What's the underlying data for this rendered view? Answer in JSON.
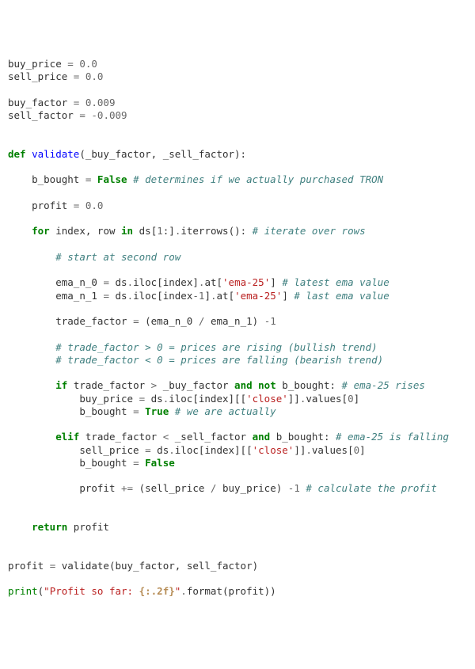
{
  "code": {
    "l01": {
      "n1": "buy_price",
      "op": "=",
      "num": "0.0"
    },
    "l02": {
      "n1": "sell_price",
      "op": "=",
      "num": "0.0"
    },
    "l04": {
      "n1": "buy_factor",
      "op": "=",
      "num": "0.009"
    },
    "l05": {
      "n1": "sell_factor",
      "op": "=",
      "num": "-0.009"
    },
    "l08": {
      "kw": "def",
      "fn": "validate",
      "p1": "(",
      "a1": "_buy_factor",
      "a2": "_sell_factor",
      "p2": "):"
    },
    "l10": {
      "n1": "b_bought",
      "op": "=",
      "kc": "False",
      "c": "# determines if we actually purchased TRON"
    },
    "l12": {
      "n1": "profit",
      "op": "=",
      "num": "0.0"
    },
    "l14": {
      "k1": "for",
      "n1": "index",
      "n2": "row",
      "k2": "in",
      "n3": "ds",
      "p1": "[",
      "m1": "1",
      "p2": ":]",
      "p3": ".",
      "n4": "iterrows",
      "p4": "():",
      "c": "# iterate over rows"
    },
    "l16": {
      "c": "# start at second row"
    },
    "l18": {
      "n1": "ema_n_0",
      "op": "=",
      "n2": "ds",
      "p1": ".",
      "n3": "iloc",
      "p2": "[",
      "n4": "index",
      "p3": "]",
      "p4": ".",
      "n5": "at",
      "p5": "[",
      "s1": "'ema-25'",
      "p6": "]",
      "c": "# latest ema value"
    },
    "l19": {
      "n1": "ema_n_1",
      "op": "=",
      "n2": "ds",
      "p1": ".",
      "n3": "iloc",
      "p2": "[",
      "n4": "index",
      "op2": "-",
      "m1": "1",
      "p3": "]",
      "p4": ".",
      "n5": "at",
      "p5": "[",
      "s1": "'ema-25'",
      "p6": "]",
      "c": "# last ema value"
    },
    "l21": {
      "n1": "trade_factor",
      "op": "=",
      "p1": "(",
      "n2": "ema_n_0",
      "op2": "/",
      "n3": "ema_n_1",
      "p2": ")",
      "op3": "-",
      "m1": "1"
    },
    "l23": {
      "c": "# trade_factor > 0 = prices are rising (bullish trend)"
    },
    "l24": {
      "c": "# trade_factor < 0 = prices are falling (bearish trend)"
    },
    "l26": {
      "k1": "if",
      "n1": "trade_factor",
      "op": ">",
      "n2": "_buy_factor",
      "k2": "and",
      "k3": "not",
      "n3": "b_bought",
      "p1": ":",
      "c": "# ema-25 rises"
    },
    "l27": {
      "n1": "buy_price",
      "op": "=",
      "n2": "ds",
      "p1": ".",
      "n3": "iloc",
      "p2": "[",
      "n4": "index",
      "p3": "][[",
      "s1": "'close'",
      "p4": "]]",
      "p5": ".",
      "n5": "values",
      "p6": "[",
      "m1": "0",
      "p7": "]"
    },
    "l28": {
      "n1": "b_bought",
      "op": "=",
      "kc": "True",
      "c": "# we are actually"
    },
    "l30": {
      "k1": "elif",
      "n1": "trade_factor",
      "op": "<",
      "n2": "_sell_factor",
      "k2": "and",
      "n3": "b_bought",
      "p1": ":",
      "c": "# ema-25 is falling"
    },
    "l31": {
      "n1": "sell_price",
      "op": "=",
      "n2": "ds",
      "p1": ".",
      "n3": "iloc",
      "p2": "[",
      "n4": "index",
      "p3": "][[",
      "s1": "'close'",
      "p4": "]]",
      "p5": ".",
      "n5": "values",
      "p6": "[",
      "m1": "0",
      "p7": "]"
    },
    "l32": {
      "n1": "b_bought",
      "op": "=",
      "kc": "False"
    },
    "l34": {
      "n1": "profit",
      "op": "+=",
      "p1": "(",
      "n2": "sell_price",
      "op2": "/",
      "n3": "buy_price",
      "p2": ")",
      "op3": "-",
      "m1": "1",
      "c": "# calculate the profit"
    },
    "l37": {
      "k1": "return",
      "n1": "profit"
    },
    "l40": {
      "n1": "profit",
      "op": "=",
      "n2": "validate",
      "p1": "(",
      "n3": "buy_factor",
      "p2": ",",
      "n4": "sell_factor",
      "p3": ")"
    },
    "l42": {
      "nb": "print",
      "p1": "(",
      "s1": "\"Profit so far: ",
      "si": "{:.2f}",
      "s2": "\"",
      "p2": ".",
      "n1": "format",
      "p3": "(",
      "n2": "profit",
      "p4": "))"
    }
  }
}
